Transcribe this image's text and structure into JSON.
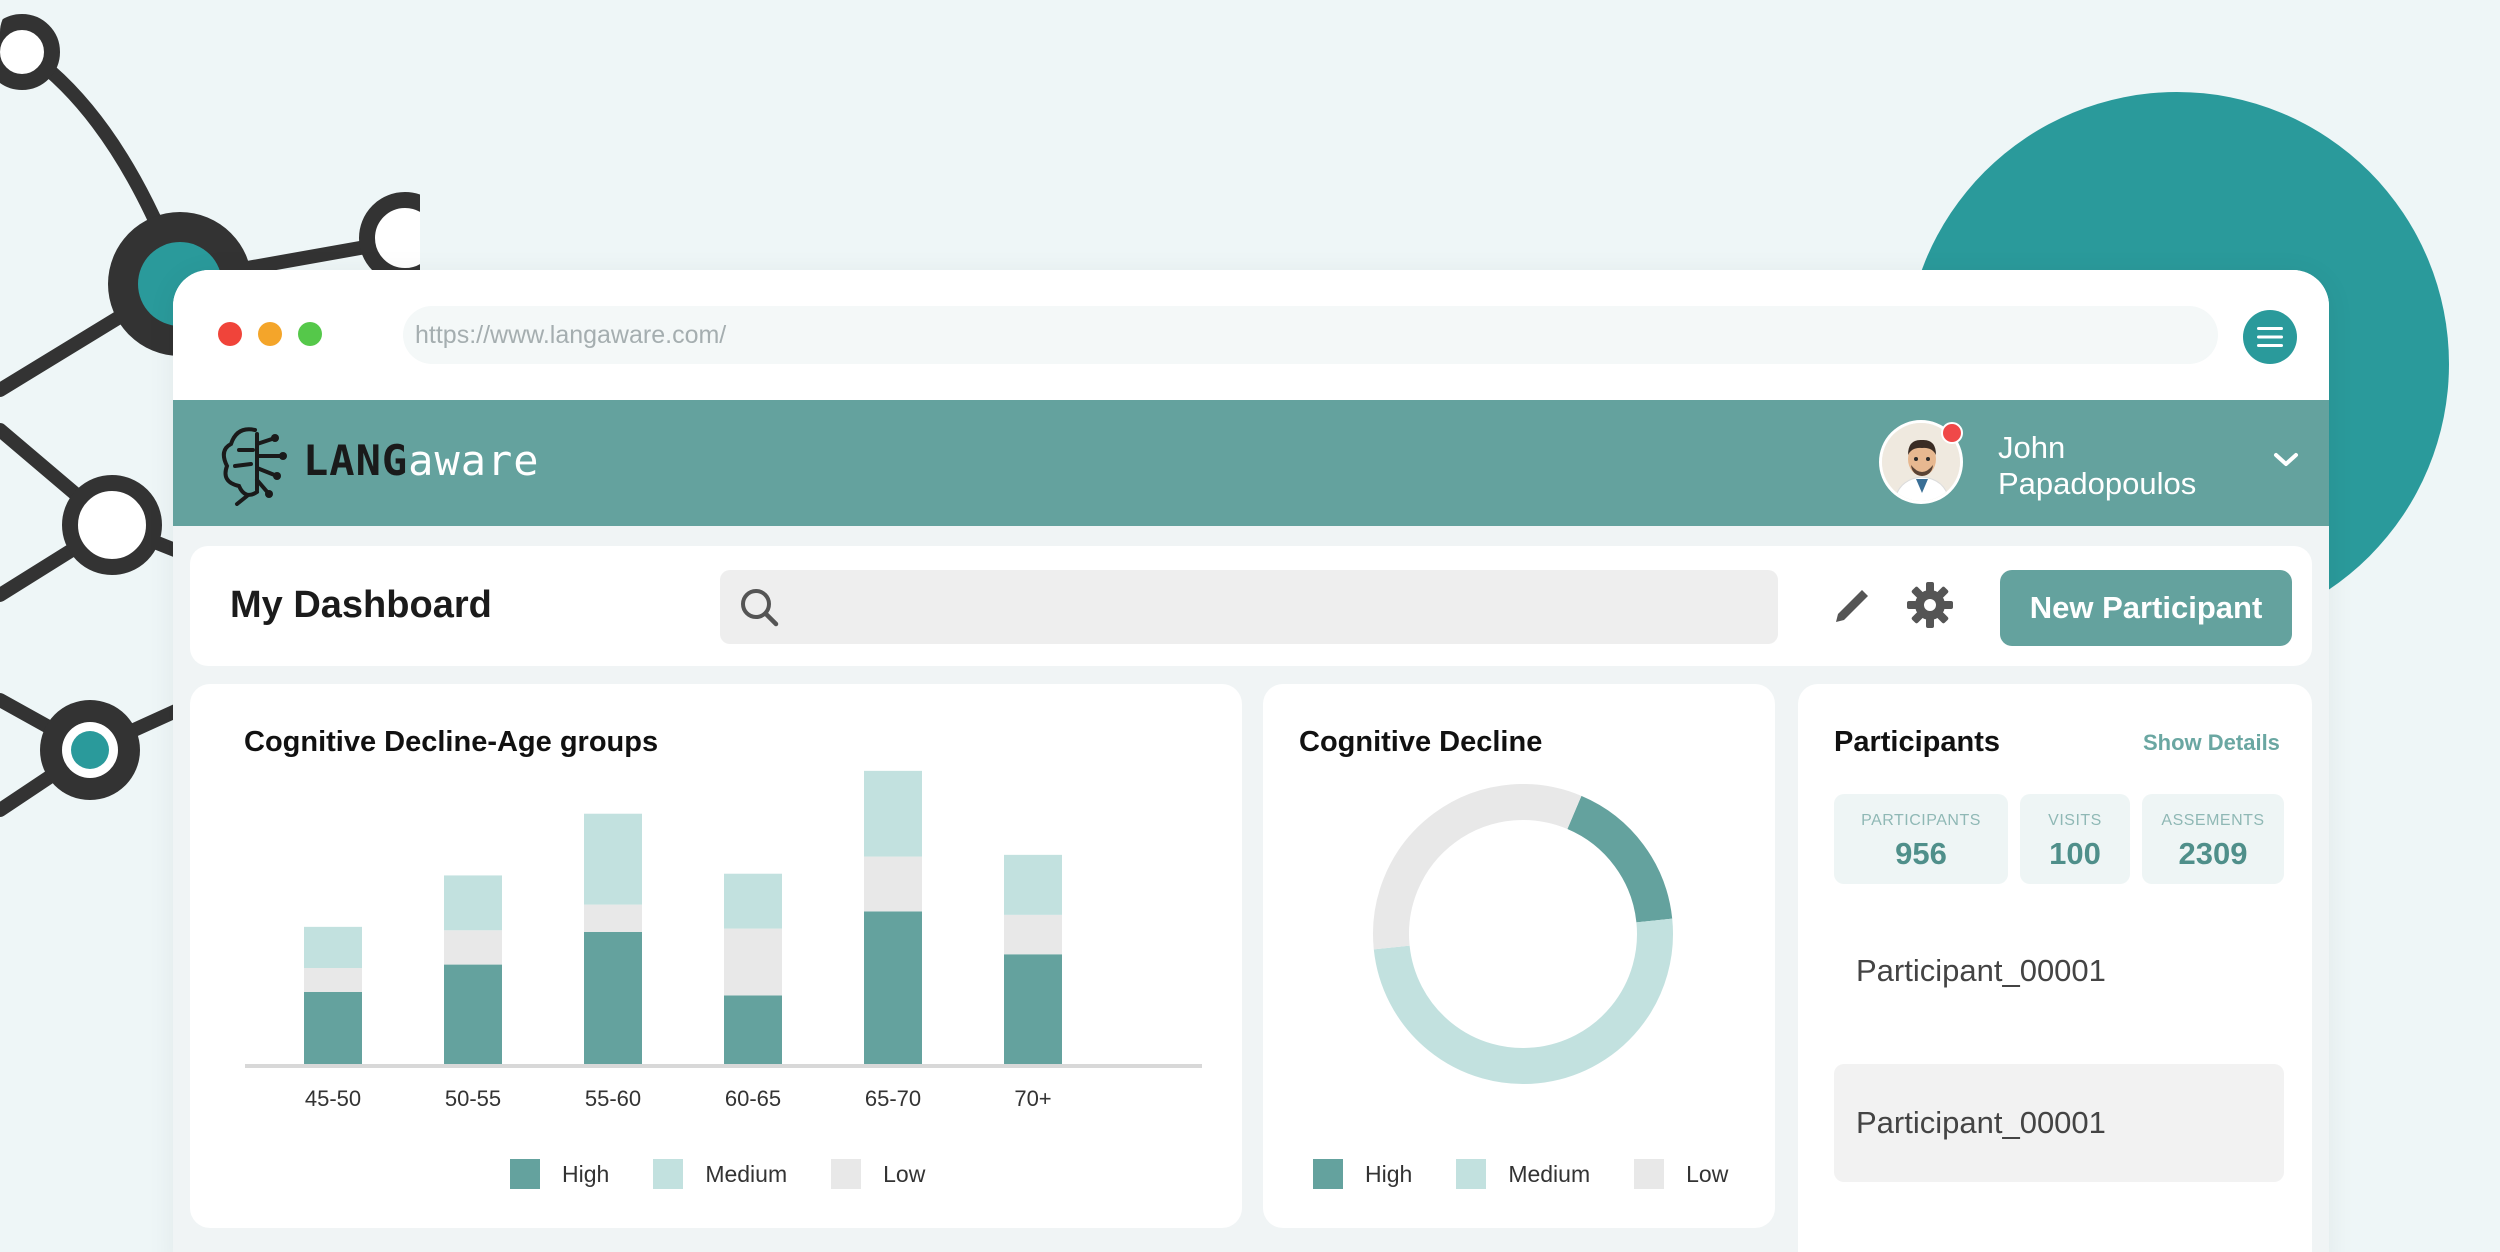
{
  "browser": {
    "url": "https://www.langaware.com/"
  },
  "header": {
    "logo_bold": "LANG",
    "logo_light": "aware",
    "user_first": "John",
    "user_last": "Papadopoulos"
  },
  "toolbar": {
    "title": "My Dashboard",
    "search_placeholder": "",
    "new_button": "New Participant"
  },
  "colors": {
    "high": "#64a29e",
    "medium": "#c2e1df",
    "low": "#e8e8e8",
    "accent": "#2a9a9b"
  },
  "legend": {
    "high": "High",
    "medium": "Medium",
    "low": "Low"
  },
  "chart_data": [
    {
      "type": "bar",
      "title": "Cognitive Decline-Age groups",
      "stacked": true,
      "categories": [
        "45-50",
        "50-55",
        "55-60",
        "60-65",
        "65-70",
        "70+"
      ],
      "series": [
        {
          "name": "High",
          "values": [
            42,
            58,
            77,
            40,
            89,
            64
          ]
        },
        {
          "name": "Low",
          "values": [
            14,
            20,
            16,
            39,
            32,
            23
          ]
        },
        {
          "name": "Medium",
          "values": [
            24,
            32,
            53,
            32,
            50,
            35
          ]
        }
      ],
      "ylim": [
        0,
        175
      ],
      "grid": false,
      "legend": "bottom"
    },
    {
      "type": "pie",
      "title": "Cognitive Decline",
      "donut": true,
      "categories": [
        "High",
        "Medium",
        "Low"
      ],
      "values": [
        17,
        50,
        33
      ],
      "legend": "bottom"
    }
  ],
  "participants": {
    "title": "Participants",
    "show_details": "Show Details",
    "stats": [
      {
        "label": "PARTICIPANTS",
        "value": "956"
      },
      {
        "label": "VISITS",
        "value": "100"
      },
      {
        "label": "ASSEMENTS",
        "value": "2309"
      }
    ],
    "rows": [
      "Participant_00001",
      "Participant_00001"
    ]
  }
}
